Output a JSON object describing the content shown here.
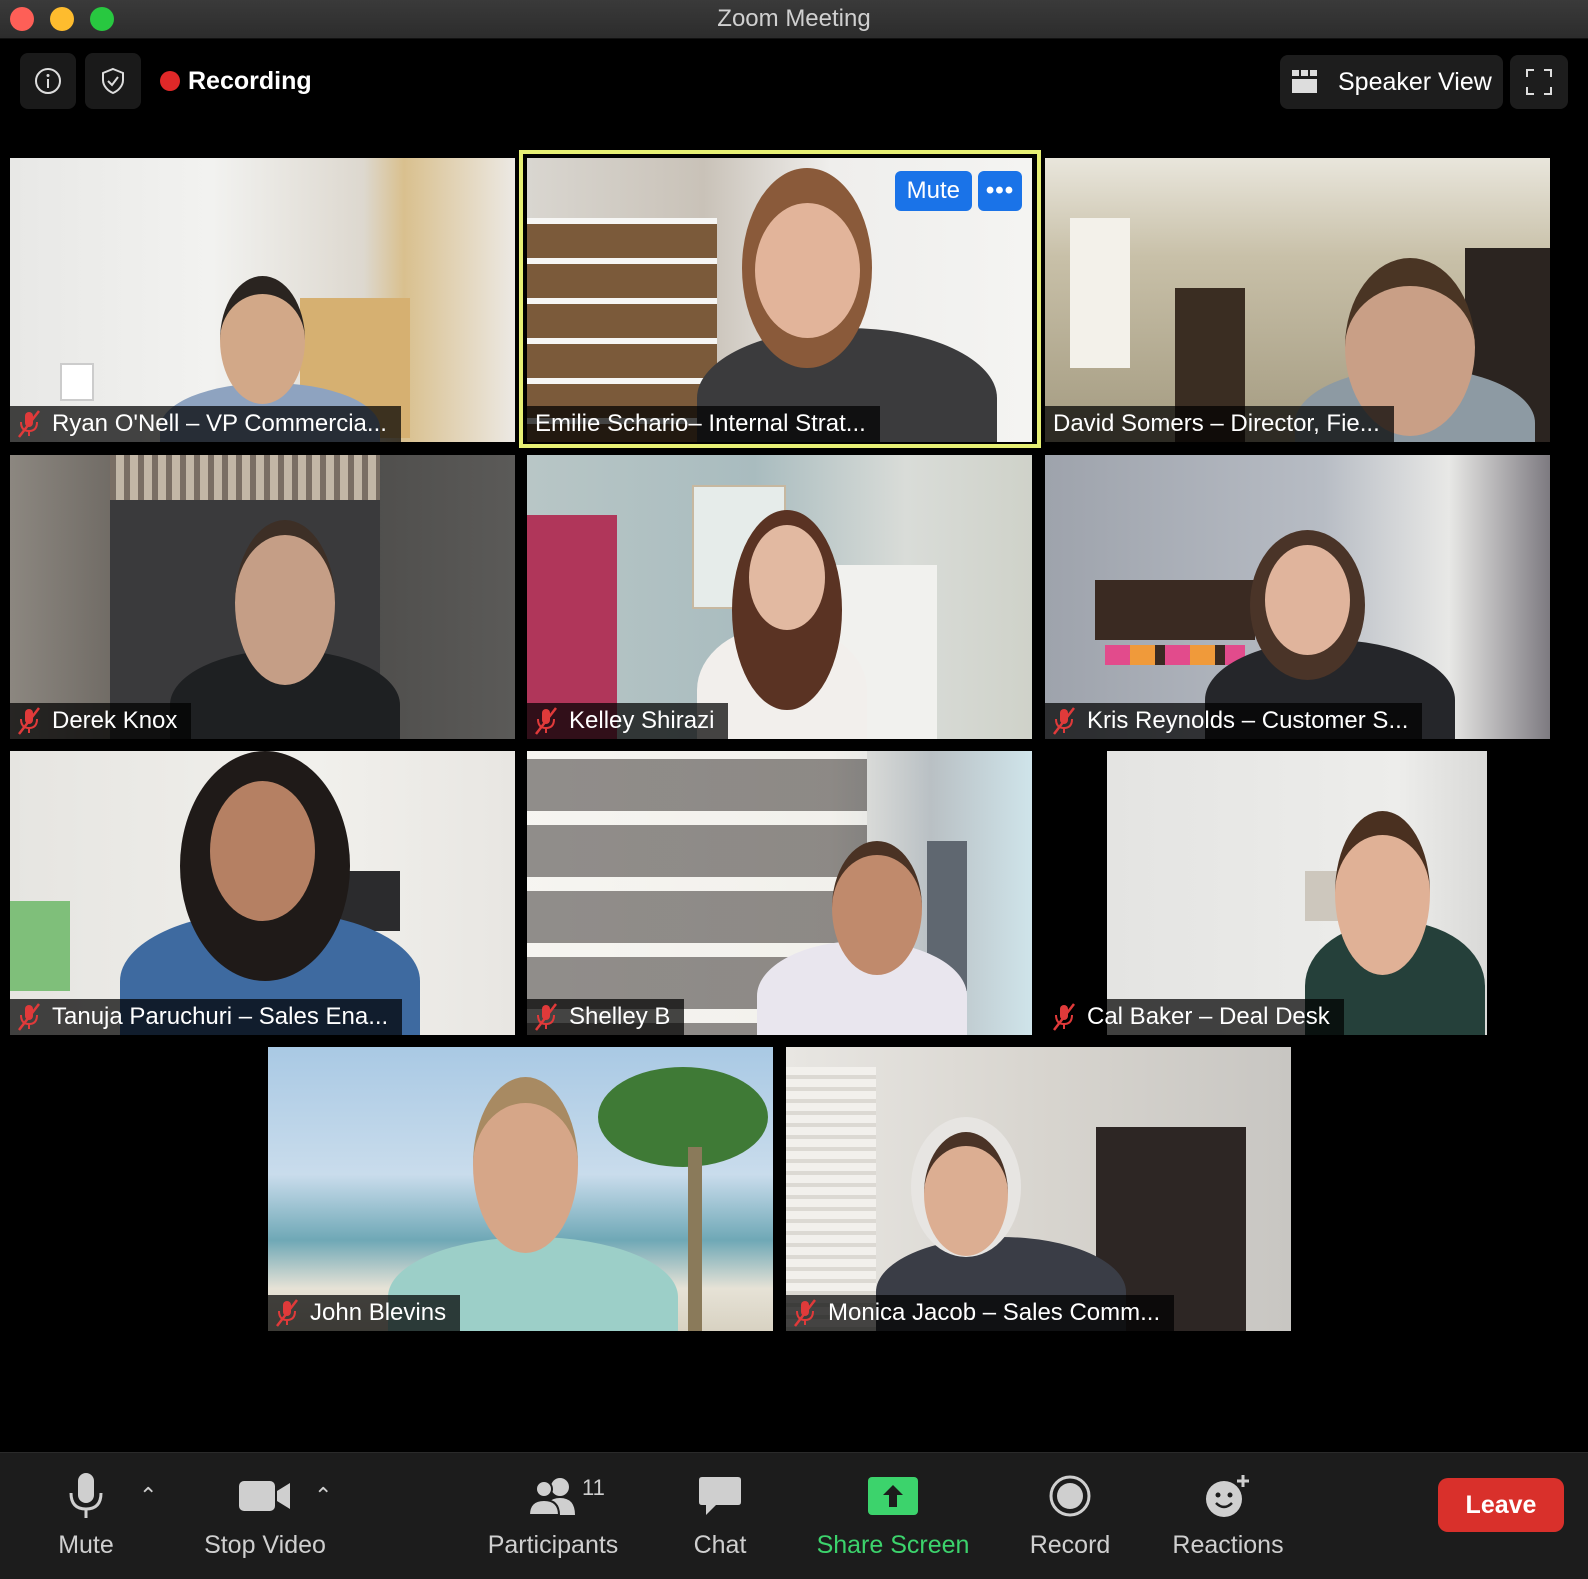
{
  "window": {
    "title": "Zoom Meeting"
  },
  "topbar": {
    "recording_label": "Recording",
    "view_label": "Speaker View"
  },
  "active_speaker": {
    "mute_label": "Mute",
    "more_label": "•••"
  },
  "participants": [
    {
      "name": "Ryan O'Nell – VP Commercia..."
    },
    {
      "name": "Emilie Schario– Internal Strat..."
    },
    {
      "name": "David Somers – Director, Fie..."
    },
    {
      "name": "Derek Knox"
    },
    {
      "name": "Kelley Shirazi"
    },
    {
      "name": "Kris Reynolds – Customer S..."
    },
    {
      "name": "Tanuja Paruchuri – Sales Ena..."
    },
    {
      "name": "Shelley B"
    },
    {
      "name": "Cal Baker – Deal Desk"
    },
    {
      "name": "John Blevins"
    },
    {
      "name": "Monica Jacob – Sales Comm..."
    }
  ],
  "toolbar": {
    "mute_label": "Mute",
    "video_label": "Stop Video",
    "participants_label": "Participants",
    "participants_count": "11",
    "chat_label": "Chat",
    "share_label": "Share Screen",
    "record_label": "Record",
    "reactions_label": "Reactions",
    "leave_label": "Leave"
  },
  "colors": {
    "active_border": "#e6ef74",
    "recording_dot": "#e02828",
    "share_green": "#3cd36c",
    "leave_red": "#d9302b",
    "mute_blue": "#1a73e8"
  }
}
